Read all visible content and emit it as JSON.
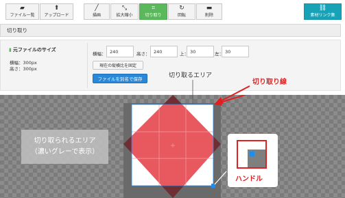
{
  "toolbar": {
    "buttons": [
      {
        "label": "ファイル一覧",
        "icon": "folder-icon"
      },
      {
        "label": "アップロード",
        "icon": "upload-icon"
      },
      {
        "label": "描画",
        "icon": "pen-icon"
      },
      {
        "label": "拡大縮小",
        "icon": "resize-icon"
      },
      {
        "label": "切り取り",
        "icon": "crop-icon"
      },
      {
        "label": "回転",
        "icon": "rotate-icon"
      },
      {
        "label": "削除",
        "icon": "trash-icon"
      }
    ],
    "link_button": {
      "label": "素材リンク集",
      "icon": "link-icon"
    }
  },
  "title": "切り取り",
  "original": {
    "heading": "元ファイルのサイズ",
    "width": "横幅：300px",
    "height": "高さ：300px"
  },
  "fields": {
    "width_label": "横幅：",
    "width_value": "240",
    "height_label": "高さ：",
    "height_value": "240",
    "top_label": "上：",
    "top_value": "30",
    "left_label": "左：",
    "left_value": "30"
  },
  "buttons": {
    "fix_ratio": "現在の縦横比を固定",
    "save_as": "ファイルを別名で保存"
  },
  "annotations": {
    "crop_area": "切り取るエリア",
    "crop_line": "切り取り線",
    "removed_area_line1": "切り取られるエリア",
    "removed_area_line2": "（濃いグレーで表示）",
    "handle": "ハンドル"
  },
  "colors": {
    "accent_green": "#5cb85c",
    "link_teal": "#17a2b8",
    "save_blue": "#2a88d8",
    "annotation_red": "#e02020",
    "shape_red": "#e8585f",
    "handle_blue": "#1e8cf0"
  }
}
